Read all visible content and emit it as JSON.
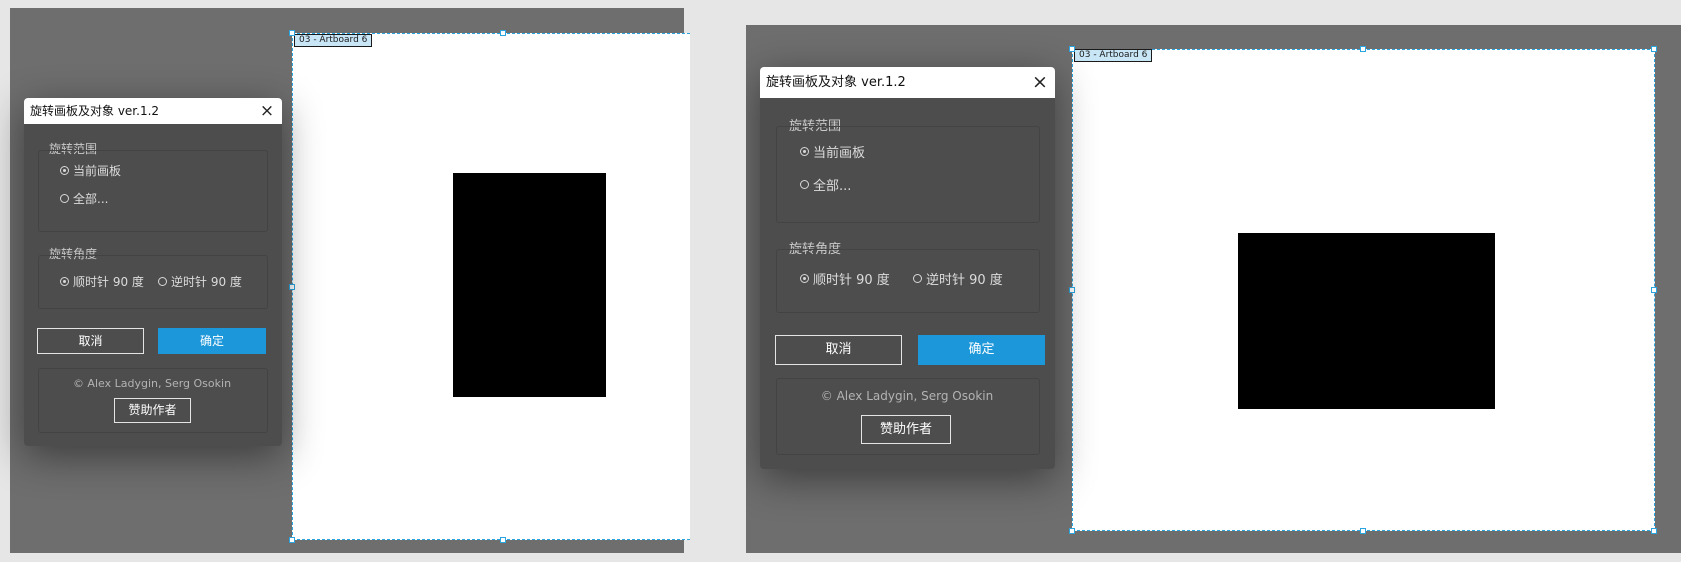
{
  "colors": {
    "workspace": "#6e6e6e",
    "dialog_bg": "#4d4d4d",
    "selection": "#2aa5e0",
    "ok_button": "#1c97d9",
    "label_bg": "#c9e6f7"
  },
  "panels": [
    {
      "state": "before",
      "artboard_label": "03 - Artboard 6",
      "dialog": {
        "title": "旋转画板及对象 ver.1.2",
        "close_icon": "×",
        "scope_group": {
          "title": "旋转范围",
          "options": [
            "当前画板",
            "全部..."
          ],
          "selected": 0
        },
        "angle_group": {
          "title": "旋转角度",
          "options": [
            "顺时针 90 度",
            "逆时针 90 度"
          ],
          "selected": 0
        },
        "cancel_label": "取消",
        "ok_label": "确定",
        "credits": "© Alex Ladygin, Serg Osokin",
        "donate_label": "赞助作者"
      }
    },
    {
      "state": "after",
      "artboard_label": "03 - Artboard 6",
      "dialog": {
        "title": "旋转画板及对象 ver.1.2",
        "close_icon": "×",
        "scope_group": {
          "title": "旋转范围",
          "options": [
            "当前画板",
            "全部..."
          ],
          "selected": 0
        },
        "angle_group": {
          "title": "旋转角度",
          "options": [
            "顺时针 90 度",
            "逆时针 90 度"
          ],
          "selected": 0
        },
        "cancel_label": "取消",
        "ok_label": "确定",
        "credits": "© Alex Ladygin, Serg Osokin",
        "donate_label": "赞助作者"
      }
    }
  ]
}
